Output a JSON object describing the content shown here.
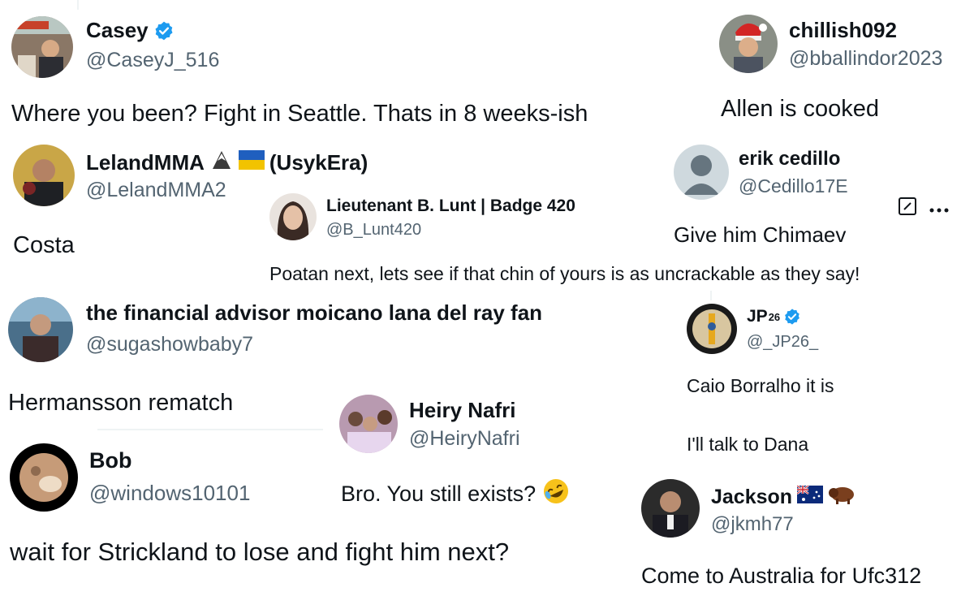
{
  "colors": {
    "verified": "#1d9bf0",
    "handle": "#536471",
    "text": "#0f1419"
  },
  "tweets": [
    {
      "name": "Casey",
      "handle": "@CaseyJ_516",
      "text": "Where you been? Fight in Seattle. Thats in 8 weeks-ish",
      "verified": true
    },
    {
      "name": "chillish092",
      "handle": "@bballindor2023",
      "text": "Allen is cooked"
    },
    {
      "name": "LelandMMA",
      "name_suffix": "(UsykEra)",
      "handle": "@LelandMMA2",
      "text": "Costa",
      "emojis": [
        "eagle-icon",
        "ukraine-flag-icon"
      ]
    },
    {
      "name": "erik cedillo",
      "handle": "@Cedillo17E",
      "text": "Give him Chimaev"
    },
    {
      "name": "Lieutenant B. Lunt | Badge 420",
      "handle": "@B_Lunt420",
      "text": "Poatan next, lets see if that chin of yours is as uncrackable as they say!"
    },
    {
      "name": "the financial advisor moicano lana del ray fan",
      "handle": "@sugashowbaby7",
      "text": "Hermansson rematch"
    },
    {
      "name": "JP",
      "name_sup": "26",
      "handle": "@_JP26_",
      "text": "Caio Borralho it is",
      "text2": "I'll talk to Dana",
      "verified": true
    },
    {
      "name": "Heiry Nafri",
      "handle": "@HeiryNafri",
      "text": "Bro. You still exists?",
      "emoji": "rolling-laughing-icon"
    },
    {
      "name": "Bob",
      "handle": "@windows10101",
      "text": "wait for Strickland to lose and fight him next?"
    },
    {
      "name": "Jackson",
      "handle": "@jkmh77",
      "text": "Come to Australia for Ufc312",
      "emojis": [
        "australia-flag-icon",
        "bison-icon"
      ]
    }
  ]
}
